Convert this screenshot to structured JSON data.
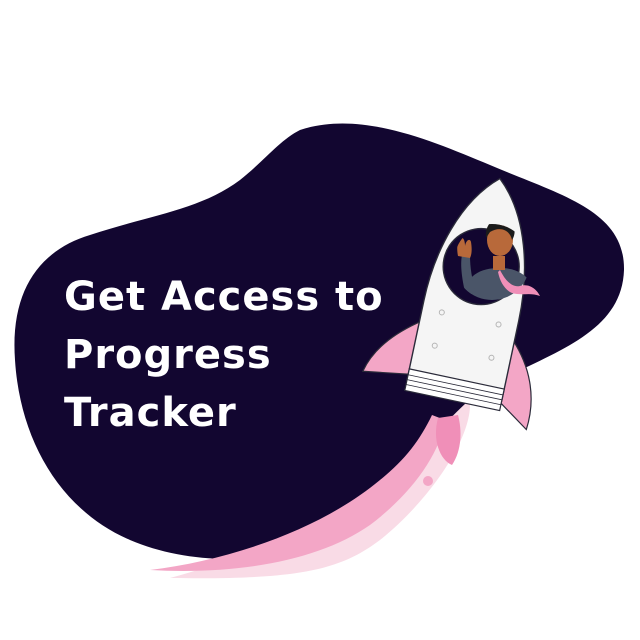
{
  "headline": {
    "line1": "Get Access to",
    "line2": "Progress",
    "line3": "Tracker"
  },
  "colors": {
    "blob": "#120630",
    "trail_light": "#f9dbe6",
    "trail_mid": "#f3a6c6",
    "fin": "#f3a6c6",
    "rocket_body": "#f5f5f5",
    "rocket_outline": "#2b2b3a",
    "window": "#120630",
    "shirt": "#4a5568",
    "tie": "#f08fb8",
    "skin": "#b8693a",
    "hair": "#1b1b1b",
    "text": "#ffffff"
  },
  "illustration": {
    "subject": "rocket-with-waving-person",
    "icons": [
      "blob-shape",
      "rocket-icon",
      "person-waving-icon",
      "pink-exhaust-trail"
    ]
  }
}
